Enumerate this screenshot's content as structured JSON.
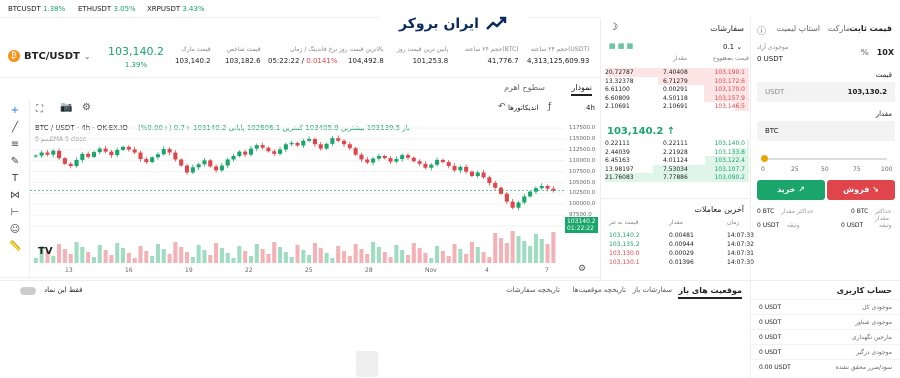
{
  "ticker": [
    {
      "symbol": "BTCUSDT",
      "change": "1.38%"
    },
    {
      "symbol": "ETHUSDT",
      "change": "3.05%"
    },
    {
      "symbol": "XRPUSDT",
      "change": "3.43%"
    }
  ],
  "logo": {
    "text": "ایران بروکر"
  },
  "header": {
    "pair": "BTC/USDT",
    "price": "103,140.2",
    "change": "1.39%",
    "stats": [
      {
        "label": "قیمت مارک",
        "value": "103,140.2"
      },
      {
        "label": "قیمت شاخص",
        "value": "103,182.6"
      },
      {
        "label": "نرخ فاندینگ / زمان",
        "value": "05:22:22",
        "extra": "0.0141%"
      },
      {
        "label": "بالاترین قیمت روز",
        "value": "104,492.8"
      },
      {
        "label": "پایین ترین قیمت روز",
        "value": "101,253.8"
      },
      {
        "label": "حجم ۲۴ ساعته(BTC)",
        "value": "41,776.7"
      },
      {
        "label": "حجم ۲۴ ساعته(USDT)",
        "value": "4,313,125,609.93"
      }
    ]
  },
  "chart_tabs": {
    "chart": "نمودار",
    "depth": "سطوح اهرم"
  },
  "chart_toolbar": {
    "interval": "4h",
    "indicators": "اندیکاتورها"
  },
  "chart_legend": {
    "title": "BTC / USDT · 4h · OK-EX.IO",
    "ohlc": "باز 103139.5 بیشترین 103405.9 کمترین 102606.1 پایانی 103140.2 +0.7 (+0.00%)",
    "volume": "حجم 9",
    "sma": "SMA 9 close"
  },
  "chart_price_tag": {
    "price": "103140.2",
    "timer": "01:22:22"
  },
  "chart_data": {
    "type": "candlestick",
    "x_ticks": [
      "13",
      "16",
      "19",
      "22",
      "25",
      "28",
      "Nov",
      "4",
      "7"
    ],
    "y_ticks": [
      "117500.0",
      "115000.0",
      "112500.0",
      "110000.0",
      "107500.0",
      "105000.0",
      "102500.0",
      "100000.0",
      "97500.0",
      "95000.0"
    ],
    "ylim": [
      95000,
      118000
    ],
    "closes": [
      111200,
      111900,
      111400,
      112300,
      110600,
      109300,
      108800,
      110200,
      111600,
      110900,
      112000,
      112800,
      112100,
      111300,
      112500,
      113200,
      112600,
      111900,
      110400,
      109700,
      110800,
      111500,
      112700,
      111900,
      110300,
      108900,
      107300,
      108500,
      109200,
      110100,
      108700,
      107800,
      108900,
      110300,
      111100,
      112100,
      111400,
      112800,
      113600,
      113000,
      112200,
      111600,
      112600,
      113800,
      114100,
      113500,
      114600,
      115000,
      113800,
      112800,
      113900,
      115200,
      114600,
      113800,
      112900,
      111400,
      110300,
      109600,
      110500,
      111100,
      110600,
      109800,
      110400,
      111300,
      110700,
      109900,
      109300,
      108400,
      109100,
      110200,
      109700,
      108800,
      107800,
      108600,
      107500,
      106500,
      107300,
      106200,
      104900,
      103800,
      102400,
      100600,
      99200,
      100400,
      101800,
      102900,
      103700,
      104200,
      103600,
      103140
    ]
  },
  "order_book": {
    "title": "سفارشات",
    "step": "0.1",
    "headers": {
      "price": "قیمت به تتر",
      "amount": "مقدار",
      "total": "مجموع"
    },
    "asks": [
      [
        "103,190.1",
        "7.40408",
        "20.72787"
      ],
      [
        "103,172.6",
        "6.71279",
        "13.32378"
      ],
      [
        "103,170.0",
        "0.00291",
        "6.61100"
      ],
      [
        "103,157.9",
        "4.50118",
        "6.60809"
      ],
      [
        "103,146.5",
        "2.10691",
        "2.10691"
      ]
    ],
    "last_price": "103,140.2",
    "bids": [
      [
        "103,140.0",
        "0.22111",
        "0.22111"
      ],
      [
        "103,133.8",
        "2.21928",
        "2.44039"
      ],
      [
        "103,122.4",
        "4.01124",
        "6.45163"
      ],
      [
        "103,107.7",
        "7.53034",
        "13.98197"
      ],
      [
        "103,090.2",
        "7.77886",
        "21.76083"
      ]
    ]
  },
  "trades": {
    "title": "آخرین معاملات",
    "headers": {
      "price": "قیمت به تتر",
      "amount": "مقدار",
      "time": "زمان"
    },
    "rows": [
      [
        "103,140.2",
        "0.00481",
        "14:07:33",
        "green"
      ],
      [
        "103,135.2",
        "0.00944",
        "14:07:32",
        "green"
      ],
      [
        "103,130.0",
        "0.00029",
        "14:07:31",
        "red"
      ],
      [
        "103,130.1",
        "0.01396",
        "14:07:30",
        "red"
      ]
    ]
  },
  "order_form": {
    "tabs": [
      "قیمت ثابت",
      "مارکت",
      "استاپ لیمیت"
    ],
    "leverage": "10X",
    "available_label": "موجودی آزاد",
    "available": "0 USDT",
    "price_label": "قیمت",
    "price": "103,130.2",
    "price_unit": "USDT",
    "amount_label": "مقدار",
    "amount_unit": "BTC",
    "slider_marks": [
      "0",
      "25",
      "50",
      "75",
      "100"
    ],
    "buy": "خرید",
    "sell": "فروش",
    "max_buy_label": "حداکثر مقدار",
    "max_buy": "0 BTC",
    "max_sell": "0 BTC",
    "margin_label": "وثیقه",
    "margin_buy": "0 USDT",
    "margin_sell": "0 USDT"
  },
  "bottom_tabs": {
    "tabs": [
      "موقعیت های باز",
      "سفارشات باز",
      "تاریخچه موقعیت‌ها",
      "تاریخچه سفارشات"
    ],
    "toggle_label": "فقط این نماد"
  },
  "account": {
    "title": "حساب کاربری",
    "rows": [
      {
        "label": "موجودی کل",
        "value": "0 USDT"
      },
      {
        "label": "موجودی شناور",
        "value": "0 USDT"
      },
      {
        "label": "مارجین نگهداری",
        "value": "0 USDT"
      },
      {
        "label": "موجودی درگیر",
        "value": "0 USDT"
      },
      {
        "label": "سود/ضرر محقق نشده",
        "value": "0.00 USDT"
      }
    ]
  }
}
